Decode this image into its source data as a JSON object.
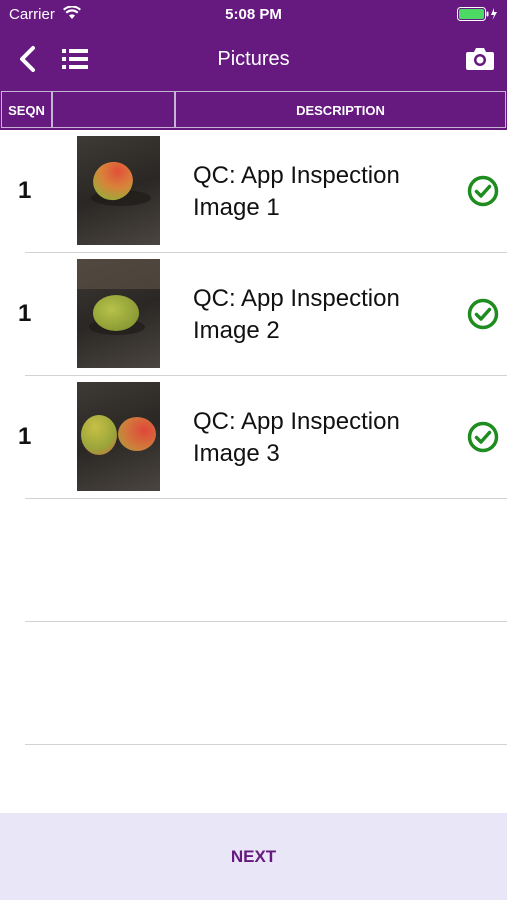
{
  "status_bar": {
    "carrier": "Carrier",
    "time": "5:08 PM",
    "battery_color": "#4cd964"
  },
  "nav": {
    "title": "Pictures",
    "back_icon": "chevron-left-icon",
    "list_icon": "list-icon",
    "camera_icon": "camera-icon"
  },
  "table": {
    "headers": [
      "SEQN",
      "",
      "DESCRIPTION"
    ],
    "rows": [
      {
        "seq": "1",
        "description": "QC: App Inspection Image 1",
        "status": "check-circle-icon"
      },
      {
        "seq": "1",
        "description": "QC: App Inspection Image 2",
        "status": "check-circle-icon"
      },
      {
        "seq": "1",
        "description": "QC: App Inspection Image 3",
        "status": "check-circle-icon"
      }
    ]
  },
  "footer": {
    "next_label": "NEXT"
  },
  "colors": {
    "primary": "#661a80",
    "check": "#1e8c1e",
    "footer_bg": "#e9e6f7"
  }
}
